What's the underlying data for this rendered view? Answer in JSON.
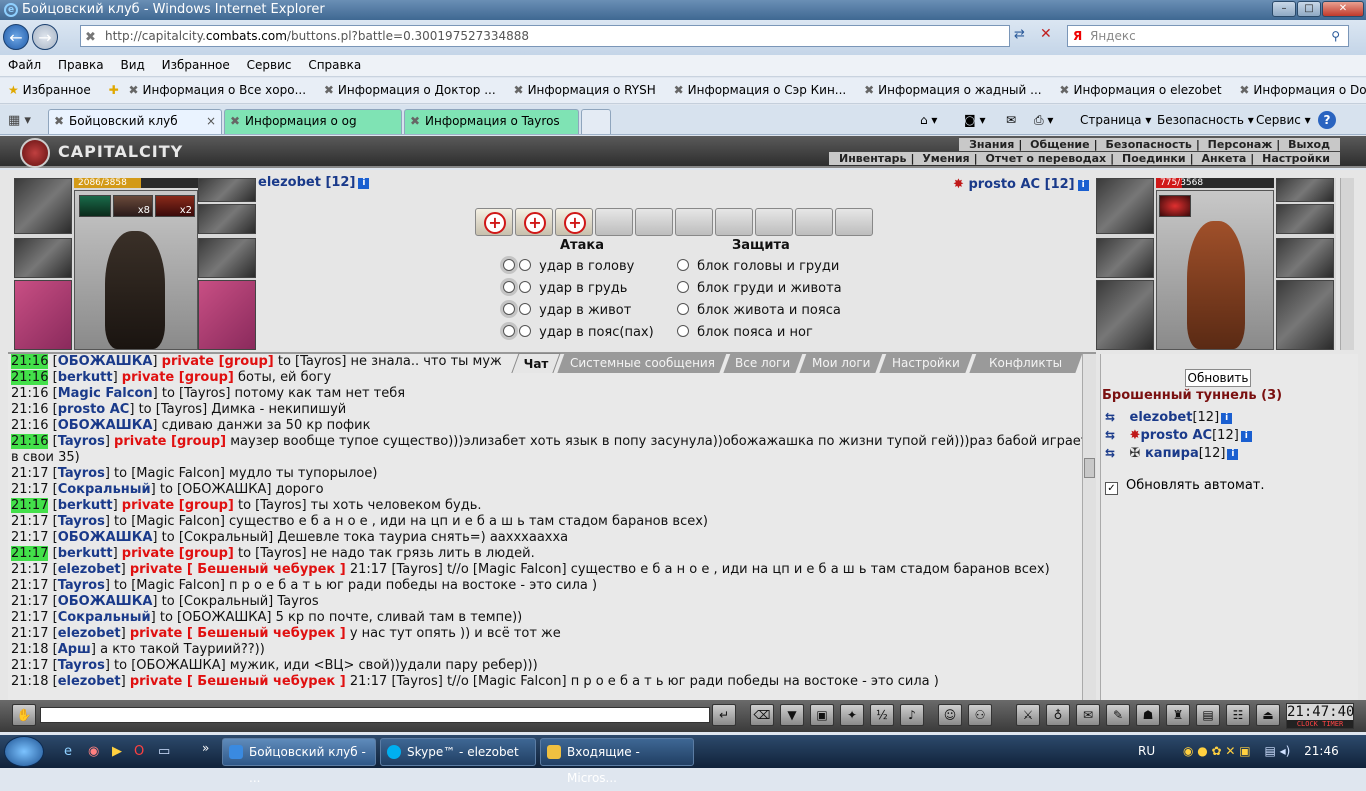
{
  "window": {
    "title": "Бойцовский клуб - Windows Internet Explorer"
  },
  "address": {
    "url_prefix": "http://capitalcity.",
    "url_domain": "combats.com",
    "url_suffix": "/buttons.pl?battle=0.300197527334888",
    "search_placeholder": "Яндекс",
    "search_brand": "Я"
  },
  "menu": [
    "Файл",
    "Правка",
    "Вид",
    "Избранное",
    "Сервис",
    "Справка"
  ],
  "favorites": {
    "label": "Избранное",
    "items": [
      "Информация о Все хоро...",
      "Информация о Доктор ...",
      "Информация о RYSH",
      "Информация о Сэр Кин...",
      "Информация о жадный ...",
      "Информация о elezobet",
      "Информация о Don Rum..."
    ]
  },
  "tabs": [
    "Бойцовский клуб",
    "Информация о og",
    "Информация о Tayros"
  ],
  "commands": {
    "page": "Страница",
    "safety": "Безопасность",
    "service": "Сервис",
    "help": "?"
  },
  "game_nav": {
    "row1": [
      "Знания",
      "Общение",
      "Безопасность",
      "Персонаж",
      "Выход"
    ],
    "row2": [
      "Инвентарь",
      "Умения",
      "Отчет о переводах",
      "Поединки",
      "Анкета",
      "Настройки"
    ]
  },
  "logo": "CAPITALCITY",
  "player": {
    "name": "elezobet [12]",
    "hp": "2086/3858",
    "hp_fraction": 0.54,
    "buff1": "x8",
    "buff2": "x2"
  },
  "enemy": {
    "name": "prosto AC [12]",
    "hp": "775/3568",
    "hp_fraction": 0.22
  },
  "combat": {
    "attack_title": "Атака",
    "defense_title": "Защита",
    "attacks": [
      "удар в голову",
      "удар в грудь",
      "удар в живот",
      "удар в пояс(пах)"
    ],
    "blocks": [
      "блок головы и груди",
      "блок груди и живота",
      "блок живота и пояса",
      "блок пояса и ног"
    ],
    "hit_slots_filled": 3,
    "hit_slots_total": 10
  },
  "chat_tabs": [
    "Чат",
    "Системные сообщения",
    "Все логи",
    "Мои логи",
    "Настройки",
    "Конфликты"
  ],
  "chat": [
    {
      "time": "21:16",
      "hl": true,
      "nick": "ОБОЖАШКА",
      "priv": "private [group]",
      "text": " to [Tayros] не знала.. что ты муж"
    },
    {
      "time": "21:16",
      "hl": true,
      "nick": "berkutt",
      "priv": "private [group]",
      "text": " боты, ей богу"
    },
    {
      "time": "21:16",
      "hl": false,
      "nick": "Magic Falcon",
      "priv": "",
      "text": " to [Tayros] потому как там нет тебя"
    },
    {
      "time": "21:16",
      "hl": false,
      "nick": "prosto AC",
      "priv": "",
      "text": " to [Tayros] Димка - некипишуй"
    },
    {
      "time": "21:16",
      "hl": false,
      "nick": "ОБОЖАШКА",
      "priv": "",
      "text": " сдиваю данжи за 50 кр пофик"
    },
    {
      "time": "21:16",
      "hl": true,
      "nick": "Tayros",
      "priv": "private [group]",
      "text": " маузер вообще тупое существо)))элизабет хоть язык в попу засунула))обожажашка по жизни тупой гей)))раз бабой играет в свои 35)"
    },
    {
      "time": "21:17",
      "hl": false,
      "nick": "Tayros",
      "priv": "",
      "text": " to [Magic Falcon] мудло ты тупорылое)"
    },
    {
      "time": "21:17",
      "hl": false,
      "nick": "Сокральный",
      "priv": "",
      "text": " to [ОБОЖАШКА] дорого"
    },
    {
      "time": "21:17",
      "hl": true,
      "nick": "berkutt",
      "priv": "private [group]",
      "text": " to [Tayros] ты хоть человеком будь."
    },
    {
      "time": "21:17",
      "hl": false,
      "nick": "Tayros",
      "priv": "",
      "text": " to [Magic Falcon] существо е б а н о е , иди на цп и е б а ш ь там стадом баранов всех)"
    },
    {
      "time": "21:17",
      "hl": false,
      "nick": "ОБОЖАШКА",
      "priv": "",
      "text": " to [Сокральный] Дешевле тока тауриа снять=) аахххаахха"
    },
    {
      "time": "21:17",
      "hl": true,
      "nick": "berkutt",
      "priv": "private [group]",
      "text": " to [Tayros] не надо так грязь лить в людей."
    },
    {
      "time": "21:17",
      "hl": false,
      "nick": "elezobet",
      "priv": "private [ Бешеный чебурек ]",
      "text": " 21:17 [Tayros] t//o [Magic Falcon] существо е б а н о е , иди на цп и е б а ш ь там стадом баранов всех)"
    },
    {
      "time": "21:17",
      "hl": false,
      "nick": "Tayros",
      "priv": "",
      "text": " to [Magic Falcon] п р о е б а т ь юг ради победы на востоке - это сила )"
    },
    {
      "time": "21:17",
      "hl": false,
      "nick": "ОБОЖАШКА",
      "priv": "",
      "text": " to [Сокральный] Tayros"
    },
    {
      "time": "21:17",
      "hl": false,
      "nick": "Сокральный",
      "priv": "",
      "text": " to [ОБОЖАШКА] 5 кр по почте, сливай там в темпе))"
    },
    {
      "time": "21:17",
      "hl": false,
      "nick": "elezobet",
      "priv": "private [ Бешеный чебурек ]",
      "text": " у нас тут опять )) и всё тот же"
    },
    {
      "time": "21:18",
      "hl": false,
      "nick": "Арш",
      "priv": "",
      "text": " а кто такой Тауриий??))"
    },
    {
      "time": "21:17",
      "hl": false,
      "nick": "Tayros",
      "priv": "",
      "text": " to [ОБОЖАШКА] мужик, иди <ВЦ> свой))удали пару ребер)))"
    },
    {
      "time": "21:18",
      "hl": false,
      "nick": "elezobet",
      "priv": "private [ Бешеный чебурек ]",
      "text": " 21:17 [Tayros] t//o [Magic Falcon] п р о е б а т ь юг ради победы на востоке - это сила )"
    }
  ],
  "battle": {
    "refresh_label": "Обновить",
    "title": "Брошенный туннель (3)",
    "players": [
      {
        "name": "elezobet",
        "level": "[12]"
      },
      {
        "name": "prosto AC",
        "level": "[12]"
      },
      {
        "name": "капира",
        "level": "[12]"
      }
    ],
    "auto_refresh_label": "Обновлять автомат.",
    "auto_refresh_checked": "✓"
  },
  "clock": {
    "time": "21:47:40",
    "label": "CLOCK TIMER"
  },
  "taskbar": {
    "items": [
      "Бойцовский клуб - ...",
      "Skype™ - elezobet",
      "Входящие - Micros..."
    ],
    "lang": "RU",
    "time": "21:46"
  },
  "colors": {
    "private": "#e01010",
    "nick": "#1a3a8a",
    "highlight": "#43e04a",
    "battle_title": "#7a1010"
  }
}
